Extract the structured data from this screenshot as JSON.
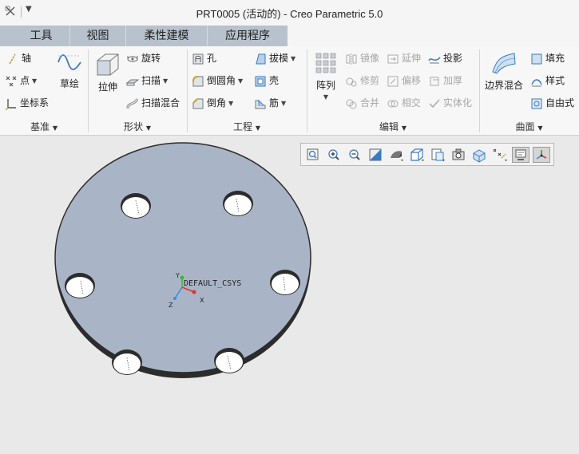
{
  "window": {
    "title": "PRT0005 (活动的) - Creo Parametric 5.0"
  },
  "tabs": [
    {
      "label": "工具"
    },
    {
      "label": "视图"
    },
    {
      "label": "柔性建模"
    },
    {
      "label": "应用程序"
    }
  ],
  "ribbon": {
    "datum": {
      "label": "基准",
      "axis": "轴",
      "point": "点",
      "csys": "坐标系",
      "sketch": "草绘"
    },
    "shapes": {
      "label": "形状",
      "extrude": "拉伸",
      "revolve": "旋转",
      "sweep": "扫描",
      "swept_blend": "扫描混合"
    },
    "engineering": {
      "label": "工程",
      "hole": "孔",
      "draft": "拔模",
      "round": "倒圆角",
      "shell": "壳",
      "chamfer": "倒角",
      "rib": "筋"
    },
    "editing": {
      "label": "编辑",
      "pattern": "阵列",
      "mirror": "镜像",
      "extend": "延伸",
      "project": "投影",
      "trim": "修剪",
      "offset": "偏移",
      "thicken": "加厚",
      "merge": "合并",
      "intersect": "相交",
      "solidify": "实体化"
    },
    "surfaces": {
      "label": "曲面",
      "boundary_blend": "边界混合",
      "fill": "填充",
      "style": "样式",
      "freestyle": "自由式"
    }
  },
  "model": {
    "csys_label": "DEFAULT_CSYS",
    "axis_x": "X",
    "axis_y": "Y",
    "axis_z": "Z"
  },
  "graphics_toolbar": {
    "icons": [
      "refit-icon",
      "zoom-in-icon",
      "zoom-out-icon",
      "repaint-icon",
      "display-style-icon",
      "saved-orientations-icon",
      "view-manager-icon",
      "perspective-icon",
      "datum-display-icon",
      "spin-center-icon",
      "annotation-display-icon",
      "csys-display-icon"
    ]
  },
  "colors": {
    "tab_strip": "#b8c2cc",
    "part_face": "#a9b5c6",
    "part_edge": "#2c2c2c",
    "csys_x": "#e03030",
    "csys_y": "#30c030",
    "csys_z": "#3090e0"
  }
}
